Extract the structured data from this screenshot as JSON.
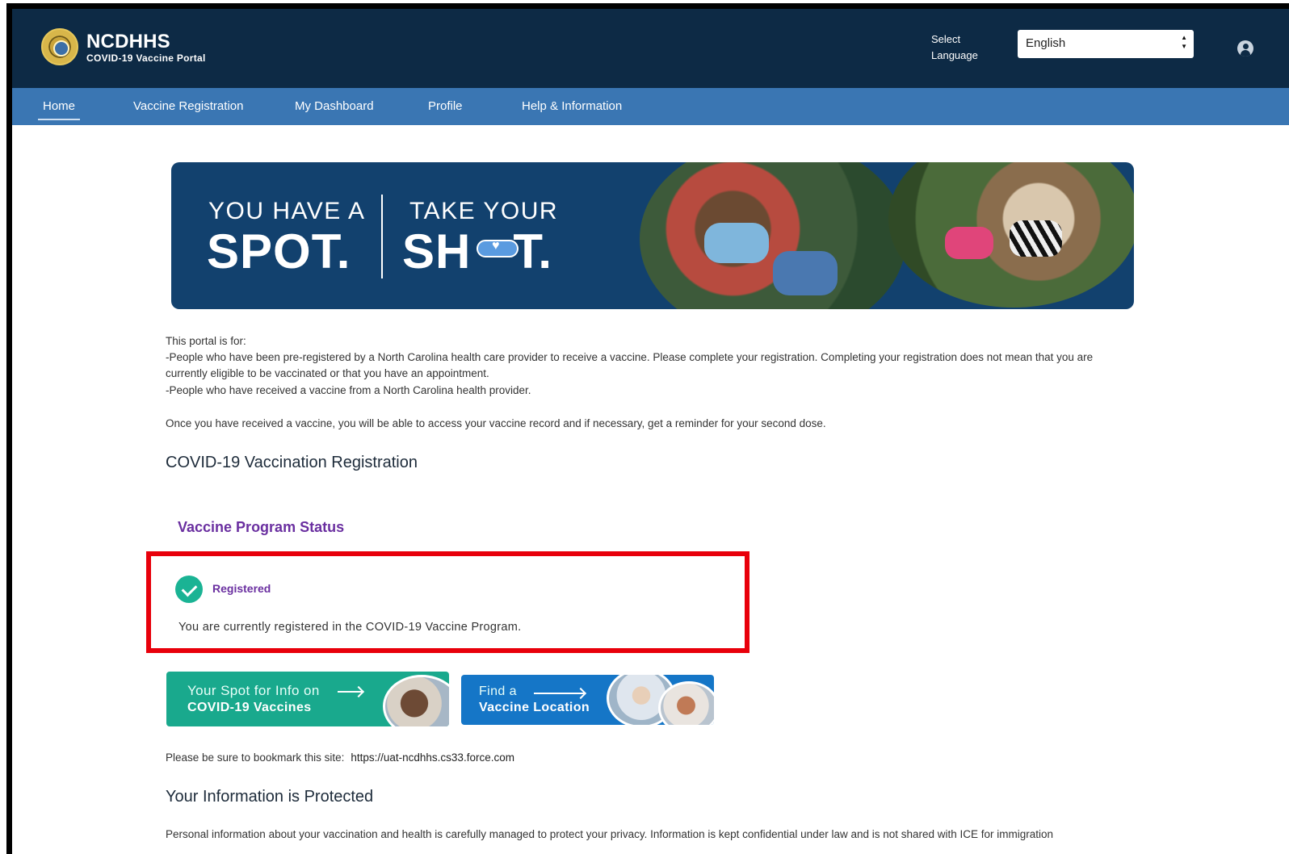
{
  "header": {
    "brand_title": "NCDHHS",
    "brand_subtitle": "COVID-19 Vaccine Portal",
    "language_label": "Select Language",
    "language_value": "English"
  },
  "nav": {
    "items": [
      {
        "label": "Home",
        "active": true
      },
      {
        "label": "Vaccine Registration"
      },
      {
        "label": "My Dashboard"
      },
      {
        "label": "Profile"
      },
      {
        "label": "Help & Information"
      }
    ]
  },
  "banner": {
    "left_small": "YOU HAVE A",
    "left_big": "SPOT.",
    "right_small": "TAKE YOUR",
    "right_big_prefix": "SH",
    "right_big_suffix": "T."
  },
  "intro": {
    "line1": "This portal is for:",
    "line2": "-People who have been pre-registered by a North Carolina health care provider to receive a vaccine. Please complete your registration. Completing your registration does not mean that you are",
    "line3": "currently eligible to be vaccinated or that you have an appointment.",
    "line4": "-People who have received a vaccine from a North Carolina health provider.",
    "line5": "Once you have received a vaccine, you will be able to access your vaccine record and if necessary, get a reminder for your second dose."
  },
  "registration": {
    "heading": "COVID-19 Vaccination Registration",
    "status_title": "Vaccine Program Status",
    "status_label": "Registered",
    "status_text": "You are currently registered in the COVID-19 Vaccine Program."
  },
  "promos": {
    "info_line1": "Your Spot for Info on",
    "info_line2": "COVID-19 Vaccines",
    "location_line1": "Find a",
    "location_line2": "Vaccine Location"
  },
  "bookmark": {
    "text": "Please be sure to bookmark this site:",
    "url": "https://uat-ncdhhs.cs33.force.com"
  },
  "privacy": {
    "heading": "Your Information is Protected",
    "text": "Personal information about your vaccination and health is carefully managed to protect your privacy. Information is kept confidential under law and is not shared with ICE for immigration"
  },
  "colors": {
    "header_bg": "#0d2a45",
    "nav_bg": "#3a76b3",
    "status_purple": "#6a2fa0",
    "highlight_red": "#e8000b",
    "check_green": "#1ab394"
  }
}
